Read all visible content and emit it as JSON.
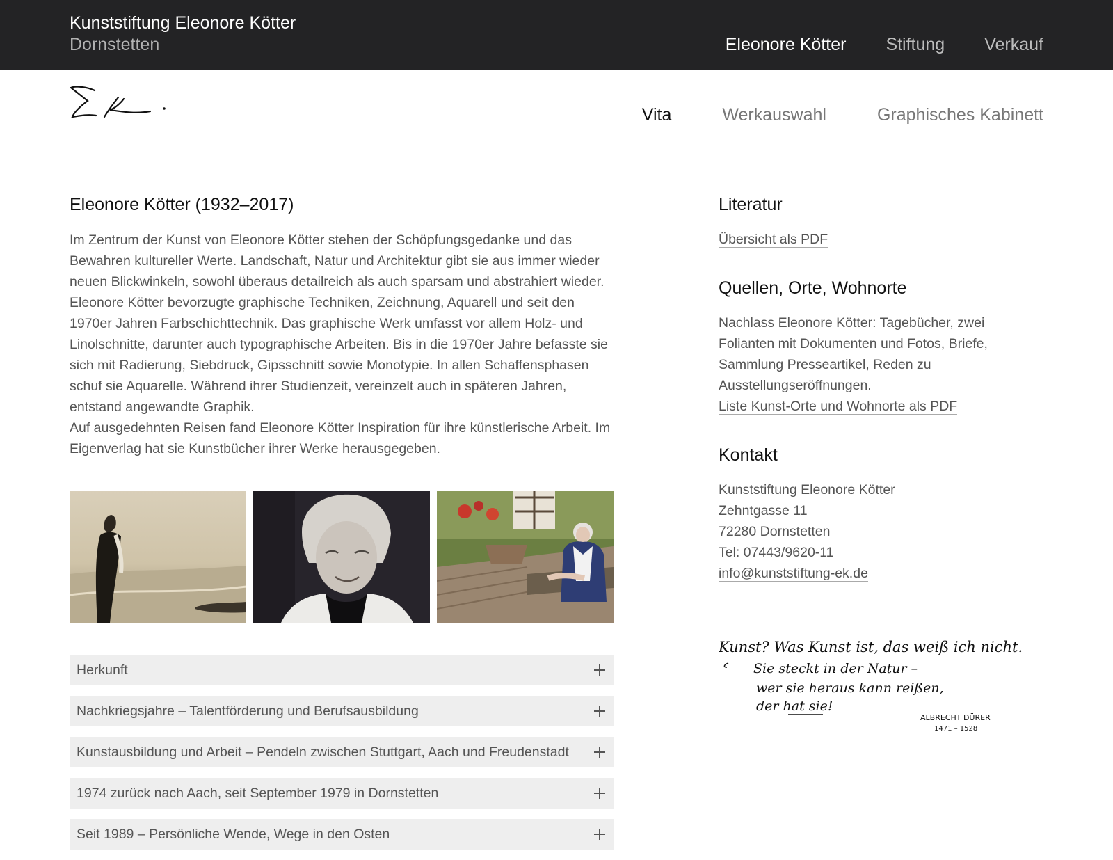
{
  "header": {
    "title": "Kunststiftung Eleonore Kötter",
    "subtitle": "Dornstetten",
    "nav": [
      {
        "label": "Eleonore Kötter",
        "active": true
      },
      {
        "label": "Stiftung",
        "active": false
      },
      {
        "label": "Verkauf",
        "active": false
      }
    ]
  },
  "subnav": [
    {
      "label": "Vita",
      "active": true
    },
    {
      "label": "Werkauswahl",
      "active": false
    },
    {
      "label": "Graphisches Kabinett",
      "active": false
    }
  ],
  "main": {
    "title": "Eleonore Kötter (1932–2017)",
    "paragraphs": [
      "Im Zentrum der Kunst von Eleonore Kötter stehen der Schöpfungsgedanke und das Bewahren kultureller Werte. Landschaft, Natur und Architektur gibt sie aus immer wieder neuen Blickwinkeln, sowohl überaus detailreich als auch sparsam und abstrahiert wieder. Eleonore Kötter bevorzugte graphische Techniken, Zeichnung, Aquarell und seit den 1970er Jahren Farbschichttechnik. Das graphische Werk umfasst vor allem Holz- und Linolschnitte, darunter auch typographische Arbeiten. Bis in die 1970er Jahre befasste sie sich mit Radierung, Siebdruck, Gipsschnitt sowie Monotypie. In allen Schaffensphasen schuf sie Aquarelle. Während ihrer Studienzeit, vereinzelt auch in späteren Jahren, entstand angewandte Graphik.",
      "Auf ausgedehnten Reisen fand Eleonore Kötter Inspiration für ihre künstlerische Arbeit. Im Eigenverlag hat sie Kunstbücher ihrer Werke herausgegeben."
    ],
    "accordion": [
      {
        "label": "Herkunft",
        "icon": "plus-icon"
      },
      {
        "label": "Nachkriegsjahre – Talentförderung und Berufsausbildung",
        "icon": "plus-icon"
      },
      {
        "label": "Kunstausbildung und Arbeit – Pendeln zwischen Stuttgart, Aach und Freudenstadt",
        "icon": "plus-icon"
      },
      {
        "label": "1974 zurück nach Aach, seit September 1979 in Dornstetten",
        "icon": "plus-icon"
      },
      {
        "label": "Seit 1989 – Persönliche Wende, Wege in den Osten",
        "icon": "plus-icon"
      }
    ]
  },
  "sidebar": {
    "literatur": {
      "heading": "Literatur",
      "link": "Übersicht als PDF"
    },
    "quellen": {
      "heading": "Quellen, Orte, Wohnorte",
      "lines": [
        "Nachlass Eleonore Kötter: Tagebücher, zwei",
        "Folianten mit Dokumenten und Fotos, Briefe,",
        "Sammlung Presseartikel, Reden zu",
        "Ausstellungseröffnungen."
      ],
      "link": "Liste Kunst-Orte und Wohnorte als PDF"
    },
    "kontakt": {
      "heading": "Kontakt",
      "name": "Kunststiftung Eleonore Kötter",
      "street": "Zehntgasse 11",
      "city": "72280 Dornstetten",
      "tel": "Tel: 07443/9620-11",
      "email": "info@kunststiftung-ek.de"
    },
    "quote_handwriting": {
      "line1": "Kunst? Was Kunst ist, das weiß ich nicht.",
      "line2": "Sie steckt in der Natur –",
      "line3": "wer sie heraus kann reißen,",
      "line4": "der hat sie!",
      "author": "ALBRECHT DÜRER",
      "years": "1471 – 1528"
    }
  },
  "colors": {
    "topbar": "#232325",
    "accordion_bg": "#eeeeee",
    "text": "#555555",
    "heading": "#111111"
  }
}
